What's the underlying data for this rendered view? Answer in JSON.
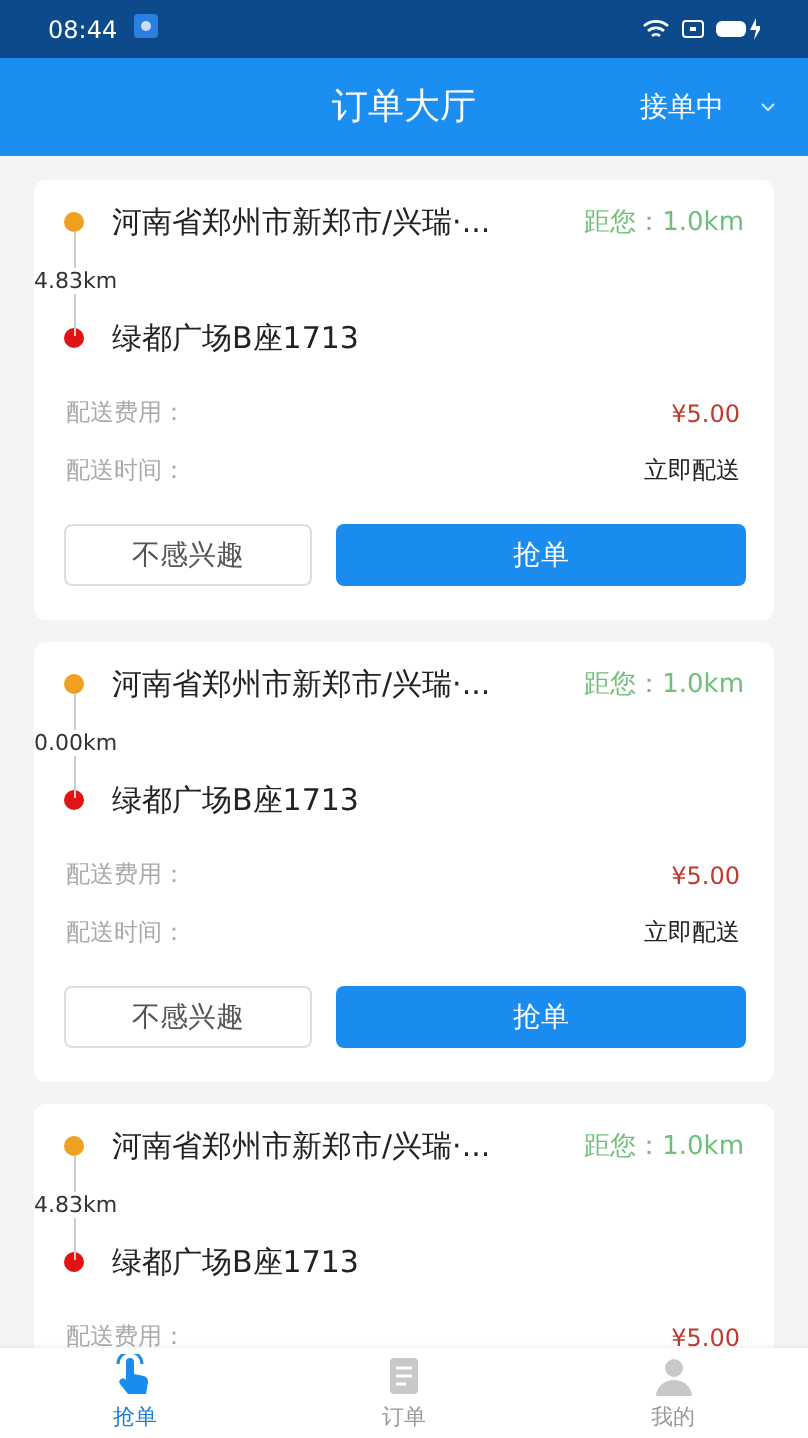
{
  "status_bar": {
    "time": "08:44"
  },
  "header": {
    "title": "订单大厅",
    "status": "接单中"
  },
  "orders": [
    {
      "pickup": "河南省郑州市新郑市/兴瑞·...",
      "distance_to_you": "距您：1.0km",
      "route_distance": "4.83km",
      "dropoff": "绿都广场B座1713",
      "fee_label": "配送费用：",
      "fee": "¥5.00",
      "time_label": "配送时间：",
      "time": "立即配送",
      "decline": "不感兴趣",
      "accept": "抢单"
    },
    {
      "pickup": "河南省郑州市新郑市/兴瑞·...",
      "distance_to_you": "距您：1.0km",
      "route_distance": "0.00km",
      "dropoff": "绿都广场B座1713",
      "fee_label": "配送费用：",
      "fee": "¥5.00",
      "time_label": "配送时间：",
      "time": "立即配送",
      "decline": "不感兴趣",
      "accept": "抢单"
    },
    {
      "pickup": "河南省郑州市新郑市/兴瑞·...",
      "distance_to_you": "距您：1.0km",
      "route_distance": "4.83km",
      "dropoff": "绿都广场B座1713",
      "fee_label": "配送费用：",
      "fee": "¥5.00"
    }
  ],
  "tabs": [
    {
      "label": "抢单",
      "selected": true
    },
    {
      "label": "订单",
      "selected": false
    },
    {
      "label": "我的",
      "selected": false
    }
  ]
}
